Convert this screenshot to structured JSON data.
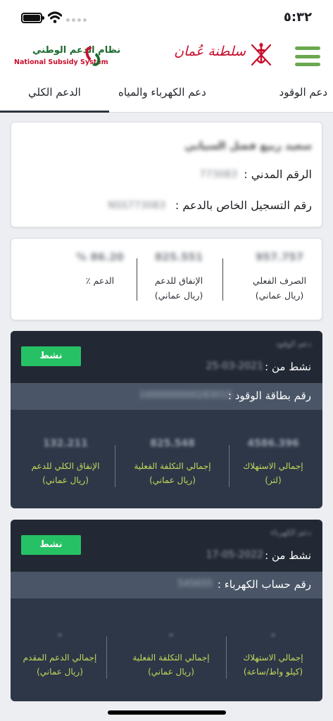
{
  "status_bar": {
    "time": "٥:٣٢"
  },
  "header": {
    "brand_ar": "سلطنة عُمان",
    "logo_ar": "نظام الدعم الوطني",
    "logo_en": "National Subsidy System"
  },
  "tabs": [
    {
      "label": "دعم الوقود"
    },
    {
      "label": "دعم الكهرباء والمياه"
    },
    {
      "label": "الدعم الكلي",
      "active": true
    }
  ],
  "user": {
    "name": "سعيد ربيع فضل السيابي",
    "civil_id_label": "الرقم المدني :",
    "civil_id_value": "773083",
    "registration_label": "رقم التسجيل الخاص بالدعم :",
    "registration_value": "NSS773083"
  },
  "stats": {
    "actual_spend": {
      "value": "957.757",
      "label_line1": "الصرف الفعلي",
      "label_line2": "(ريال عماني)"
    },
    "subsidy_spend": {
      "value": "825.551",
      "label_line1": "الإنفاق للدعم",
      "label_line2": "(ريال عماني)"
    },
    "subsidy_pct": {
      "value": "% 86.20",
      "label_line1": "الدعم ٪"
    }
  },
  "fuel": {
    "name": "دعم الوقود",
    "status": "نشط",
    "active_from_label": "نشط من :",
    "active_from_date": "25-03-2021",
    "card_label": "رقم بطاقة الوقود :",
    "card_value": "1000000000283015",
    "consumption": {
      "value": "4586.396",
      "label_line1": "إجمالي الاستهلاك",
      "label_line2": "(لتر)"
    },
    "actual_cost": {
      "value": "825.548",
      "label_line1": "إجمالي التكلفة الفعلية",
      "label_line2": "(ريال عماني)"
    },
    "total_subsidy_spend": {
      "value": "132.211",
      "label_line1": "الإنفاق الكلي للدعم",
      "label_line2": "(ريال عماني)"
    }
  },
  "electricity": {
    "name": "دعم الكهرباء",
    "status": "نشط",
    "active_from_label": "نشط من :",
    "active_from_date": "17-05-2022",
    "account_label": "رقم حساب الكهرباء :",
    "account_value": "545655",
    "consumption": {
      "value": "-",
      "label_line1": "إجمالي الاستهلاك",
      "label_line2": "(كيلو واط/ساعة)"
    },
    "actual_cost": {
      "value": "-",
      "label_line1": "إجمالي التكلفة الفعلية",
      "label_line2": "(ريال عماني)"
    },
    "subsidy_provided": {
      "value": "-",
      "label_line1": "إجمالي الدعم المقدم",
      "label_line2": "(ريال عماني)"
    }
  },
  "colors": {
    "accent_green": "#27c165",
    "hamburger": "#6aa84f",
    "service_dark": "#2d3748",
    "label_yellow": "#c3d85a",
    "brand_red": "#c8102e"
  },
  "icons": [
    "battery-icon",
    "wifi-icon",
    "signal-icon",
    "hamburger-menu-icon",
    "oman-emblem-icon",
    "nss-logo-icon"
  ]
}
